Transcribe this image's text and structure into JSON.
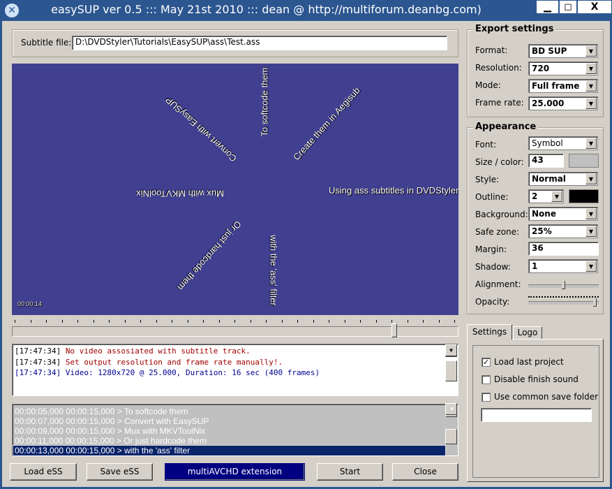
{
  "window": {
    "title": "easySUP ver 0.5 ::: May 21st 2010 ::: dean @ http://multiforum.deanbg.com)",
    "minimize": "▁",
    "maximize": "◻",
    "close": "X"
  },
  "subtitle_file": {
    "label": "Subtitle file:",
    "value": "D:\\DVDStyler\\Tutorials\\EasySUP\\ass\\Test.ass"
  },
  "preview": {
    "timestamp": "00:00:14",
    "subtitles": [
      "To softcode them",
      "Create them in Aegisub",
      "Convert with EasySUP",
      "Mux with MKVToolNix",
      "Using ass subtitles in DVDStyler",
      "Or just hardcode them",
      "with the 'ass' filter"
    ],
    "background": "#403f90"
  },
  "timeline": {
    "position_fraction": 0.86
  },
  "log": [
    {
      "text": "[17:47:34] ",
      "msg": "No video assosiated with subtitle track.",
      "color": "#a00000"
    },
    {
      "text": "[17:47:34] ",
      "msg": "Set output resolution and frame rate manually!.",
      "color": "#a00000"
    },
    {
      "text": "[17:47:34] ",
      "msg": "Video: 1280x720 @ 25.000, Duration: 16 sec (400 frames)",
      "color": "#000090"
    }
  ],
  "subtitle_list": [
    "00:00:05,000 00:00:15,000 > To softcode them",
    "00:00:07,000 00:00:15,000 > Convert with EasySUP",
    "00:00:09,000 00:00:15,000 > Mux with MKVToolNix",
    "00:00:11,000 00:00:15,000 > Or just hardcode them",
    "00:00:13,000 00:00:15,000 > with the 'ass' filter"
  ],
  "buttons": {
    "load": "Load eSS",
    "save": "Save eSS",
    "extension": "multiAVCHD extension",
    "start": "Start",
    "close": "Close"
  },
  "export": {
    "title": "Export settings",
    "format_label": "Format:",
    "format": "BD SUP",
    "resolution_label": "Resolution:",
    "resolution": "720",
    "mode_label": "Mode:",
    "mode": "Full frame",
    "framerate_label": "Frame rate:",
    "framerate": "25.000"
  },
  "appearance": {
    "title": "Appearance",
    "font_label": "Font:",
    "font": "Symbol",
    "size_label": "Size / color:",
    "size": "43",
    "primary_color": "#c0c0c0",
    "style_label": "Style:",
    "style": "Normal",
    "outline_label": "Outline:",
    "outline": "2",
    "outline_color": "#000000",
    "background_label": "Background:",
    "background": "None",
    "safezone_label": "Safe zone:",
    "safezone": "25%",
    "margin_label": "Margin:",
    "margin": "36",
    "shadow_label": "Shadow:",
    "shadow": "1",
    "alignment_label": "Alignment:",
    "alignment_fraction": 0.5,
    "opacity_label": "Opacity:",
    "opacity_fraction": 0.97
  },
  "tabs": {
    "settings": "Settings",
    "logo": "Logo"
  },
  "settings": {
    "load_last": "Load last project",
    "load_last_checked": true,
    "disable_sound": "Disable finish sound",
    "disable_sound_checked": false,
    "common_folder": "Use common save folder",
    "common_folder_checked": false,
    "folder_value": ""
  }
}
